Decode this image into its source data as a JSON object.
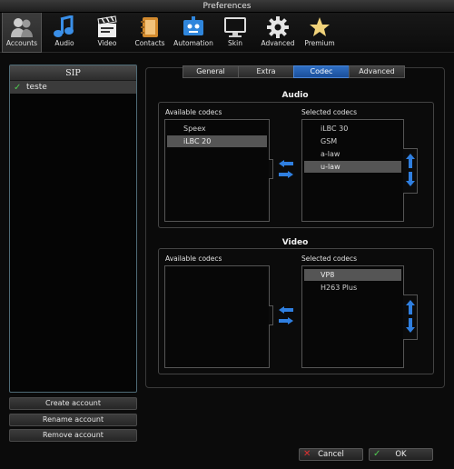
{
  "window": {
    "title": "Preferences"
  },
  "toolbar": {
    "items": [
      {
        "label": "Accounts",
        "icon": "accounts-icon",
        "active": true
      },
      {
        "label": "Audio",
        "icon": "audio-icon"
      },
      {
        "label": "Video",
        "icon": "video-icon"
      },
      {
        "label": "Contacts",
        "icon": "contacts-icon"
      },
      {
        "label": "Automation",
        "icon": "automation-icon"
      },
      {
        "label": "Skin",
        "icon": "skin-icon"
      },
      {
        "label": "Advanced",
        "icon": "gear-icon"
      },
      {
        "label": "Premium",
        "icon": "star-icon"
      }
    ]
  },
  "accounts": {
    "header": "SIP",
    "list": [
      {
        "name": "teste",
        "checked": true
      }
    ],
    "create_label": "Create account",
    "rename_label": "Rename account",
    "remove_label": "Remove account"
  },
  "tabs": [
    {
      "label": "General"
    },
    {
      "label": "Extra"
    },
    {
      "label": "Codec",
      "active": true
    },
    {
      "label": "Advanced"
    }
  ],
  "audio": {
    "title": "Audio",
    "available_label": "Available codecs",
    "selected_label": "Selected codecs",
    "available": [
      "Speex",
      "iLBC 20"
    ],
    "available_selected": "iLBC 20",
    "selected": [
      "iLBC 30",
      "GSM",
      "a-law",
      "u-law"
    ],
    "selected_selected": "u-law"
  },
  "video": {
    "title": "Video",
    "available_label": "Available codecs",
    "selected_label": "Selected codecs",
    "available": [],
    "selected": [
      "VP8",
      "H263 Plus"
    ],
    "selected_selected": "VP8"
  },
  "footer": {
    "cancel_label": "Cancel",
    "ok_label": "OK"
  },
  "colors": {
    "accent_blue": "#2f6fc4",
    "arrow_blue": "#2f7fe0",
    "check_green": "#4fc94f",
    "cancel_red": "#e03030"
  }
}
